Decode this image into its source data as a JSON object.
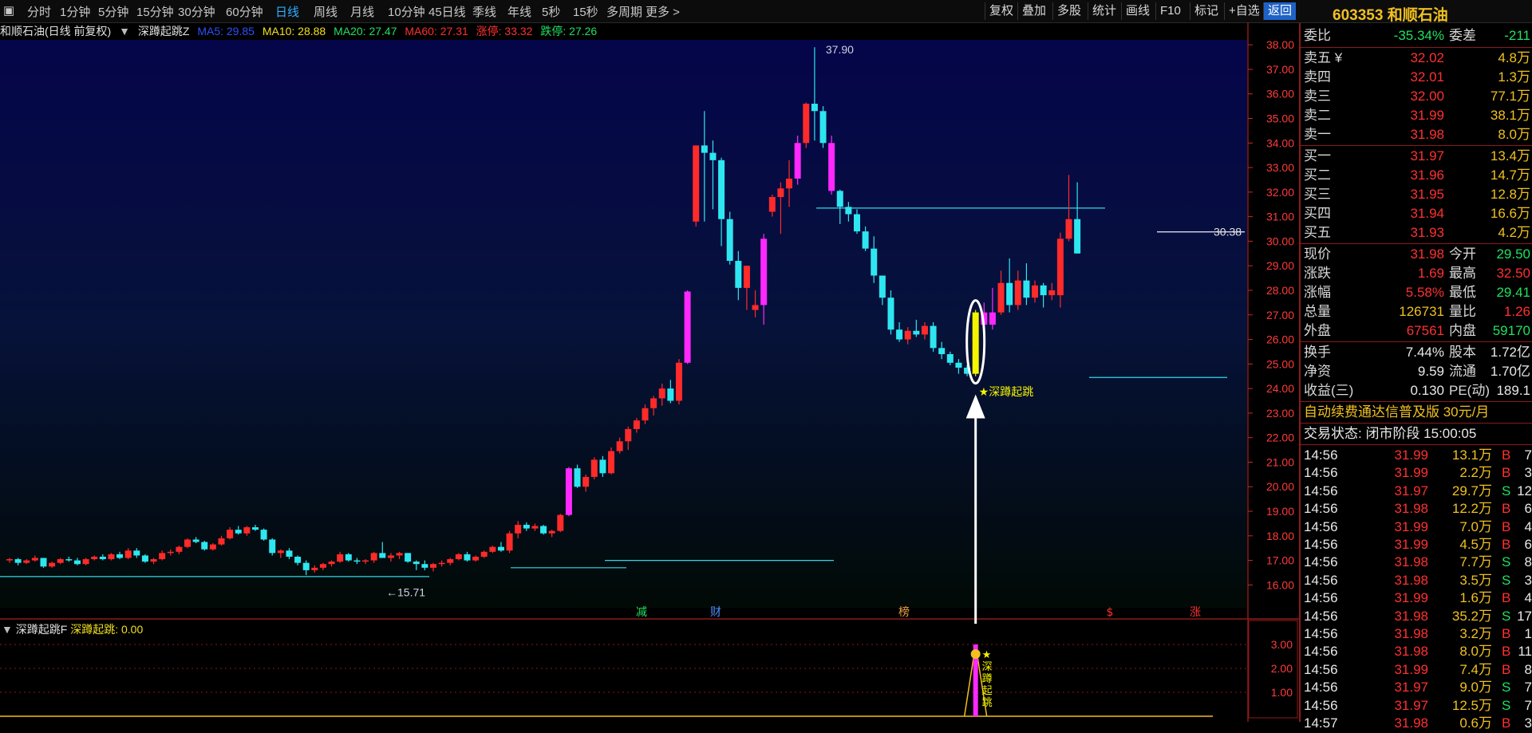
{
  "topbar": {
    "periods": [
      "分时",
      "1分钟",
      "5分钟",
      "15分钟",
      "30分钟",
      "60分钟",
      "日线",
      "周线",
      "月线",
      "10分钟",
      "45日线",
      "季线",
      "年线",
      "5秒",
      "15秒",
      "多周期",
      "更多 >"
    ],
    "active_period": "日线",
    "buttons": [
      "复权",
      "叠加",
      "多股",
      "统计",
      "画线",
      "F10",
      "标记",
      "+自选",
      "返回"
    ]
  },
  "stock": {
    "code": "603353",
    "name": "和顺石油"
  },
  "infobar": {
    "title": "和顺石油(日线 前复权)",
    "indicator_name": "深蹲起跳Z",
    "ma5": "MA5: 29.85",
    "ma10": "MA10: 28.88",
    "ma20": "MA20: 27.47",
    "ma60": "MA60: 27.31",
    "limit_up": "涨停: 33.32",
    "limit_down": "跌停: 27.26"
  },
  "sub_indicator": {
    "name": "深蹲起跳F",
    "value_label": "深蹲起跳: 0.00"
  },
  "chart_data": {
    "type": "candlestick",
    "y_axis": {
      "ticks": [
        16,
        17,
        18,
        19,
        20,
        21,
        22,
        23,
        24,
        25,
        26,
        27,
        28,
        29,
        30,
        31,
        32,
        33,
        34,
        35,
        36,
        37,
        38
      ],
      "ylim": [
        15.2,
        38.2
      ]
    },
    "annotations": {
      "high": "37.90",
      "low": "←15.71",
      "current": "30.38",
      "signal": "★深蹲起跳"
    },
    "event_markers": [
      "减",
      "财",
      "榜",
      "$",
      "涨"
    ],
    "sub_axis": {
      "ticks": [
        "3.00",
        "2.00",
        "1.00"
      ],
      "ylim": [
        0,
        3.6
      ]
    },
    "sub_signal_text": "★深蹲起跳",
    "candles": [
      [
        17.0,
        17.1,
        16.9,
        17.05
      ],
      [
        17.05,
        17.1,
        16.8,
        16.9
      ],
      [
        16.9,
        17.05,
        16.85,
        17.0
      ],
      [
        17.0,
        17.2,
        16.95,
        17.1
      ],
      [
        17.1,
        17.1,
        16.7,
        16.75
      ],
      [
        16.75,
        16.95,
        16.7,
        16.9
      ],
      [
        16.9,
        17.1,
        16.85,
        17.05
      ],
      [
        17.05,
        17.15,
        16.95,
        17.0
      ],
      [
        17.0,
        17.1,
        16.8,
        16.85
      ],
      [
        16.85,
        17.1,
        16.8,
        17.05
      ],
      [
        17.05,
        17.2,
        17.0,
        17.15
      ],
      [
        17.15,
        17.25,
        17.0,
        17.05
      ],
      [
        17.05,
        17.3,
        17.0,
        17.25
      ],
      [
        17.25,
        17.35,
        17.05,
        17.1
      ],
      [
        17.1,
        17.5,
        17.05,
        17.4
      ],
      [
        17.4,
        17.5,
        17.1,
        17.2
      ],
      [
        17.2,
        17.25,
        16.9,
        16.95
      ],
      [
        16.95,
        17.1,
        16.85,
        17.05
      ],
      [
        17.05,
        17.4,
        17.0,
        17.3
      ],
      [
        17.3,
        17.45,
        17.2,
        17.35
      ],
      [
        17.35,
        17.6,
        17.25,
        17.55
      ],
      [
        17.55,
        17.9,
        17.5,
        17.85
      ],
      [
        17.85,
        17.95,
        17.7,
        17.75
      ],
      [
        17.75,
        17.8,
        17.4,
        17.45
      ],
      [
        17.45,
        17.7,
        17.4,
        17.65
      ],
      [
        17.65,
        18.0,
        17.6,
        17.9
      ],
      [
        17.9,
        18.35,
        17.85,
        18.25
      ],
      [
        18.25,
        18.4,
        18.05,
        18.1
      ],
      [
        18.1,
        18.4,
        18.0,
        18.35
      ],
      [
        18.35,
        18.45,
        18.2,
        18.25
      ],
      [
        18.25,
        18.3,
        17.8,
        17.85
      ],
      [
        17.85,
        17.9,
        17.2,
        17.3
      ],
      [
        17.3,
        17.45,
        17.1,
        17.4
      ],
      [
        17.4,
        17.5,
        17.05,
        17.15
      ],
      [
        17.15,
        17.2,
        16.8,
        16.9
      ],
      [
        16.9,
        17.0,
        16.4,
        16.6
      ],
      [
        16.6,
        16.8,
        16.5,
        16.7
      ],
      [
        16.7,
        16.9,
        16.6,
        16.85
      ],
      [
        16.85,
        17.0,
        16.75,
        16.95
      ],
      [
        16.95,
        17.35,
        16.9,
        17.25
      ],
      [
        17.25,
        17.3,
        16.95,
        17.0
      ],
      [
        17.0,
        17.1,
        16.85,
        16.95
      ],
      [
        16.95,
        17.05,
        16.85,
        17.0
      ],
      [
        17.0,
        17.35,
        16.9,
        17.3
      ],
      [
        17.3,
        17.75,
        17.2,
        17.1
      ],
      [
        17.1,
        17.3,
        16.95,
        17.2
      ],
      [
        17.2,
        17.35,
        17.05,
        17.3
      ],
      [
        17.3,
        17.3,
        16.9,
        16.95
      ],
      [
        16.95,
        17.0,
        16.6,
        16.85
      ],
      [
        16.85,
        17.0,
        16.6,
        16.7
      ],
      [
        16.7,
        16.9,
        16.55,
        16.85
      ],
      [
        16.85,
        17.0,
        16.75,
        16.9
      ],
      [
        16.9,
        17.1,
        16.8,
        17.05
      ],
      [
        17.05,
        17.3,
        17.0,
        17.25
      ],
      [
        17.25,
        17.35,
        16.95,
        17.0
      ],
      [
        17.0,
        17.2,
        16.95,
        17.15
      ],
      [
        17.15,
        17.4,
        17.1,
        17.35
      ],
      [
        17.35,
        17.6,
        17.3,
        17.55
      ],
      [
        17.55,
        17.75,
        17.35,
        17.4
      ],
      [
        17.4,
        18.2,
        17.3,
        18.1
      ],
      [
        18.1,
        18.6,
        17.9,
        18.45
      ],
      [
        18.45,
        18.55,
        18.2,
        18.3
      ],
      [
        18.3,
        18.5,
        18.2,
        18.4
      ],
      [
        18.4,
        18.45,
        18.05,
        18.1
      ],
      [
        18.1,
        18.25,
        17.95,
        18.2
      ],
      [
        18.2,
        18.9,
        18.15,
        18.85
      ],
      [
        18.85,
        20.8,
        18.8,
        20.75
      ],
      [
        20.75,
        20.9,
        19.95,
        20.0
      ],
      [
        20.0,
        20.5,
        19.8,
        20.4
      ],
      [
        20.4,
        21.2,
        20.3,
        21.1
      ],
      [
        21.1,
        21.25,
        20.4,
        20.55
      ],
      [
        20.55,
        21.6,
        20.5,
        21.45
      ],
      [
        21.45,
        22.0,
        21.35,
        21.85
      ],
      [
        21.85,
        22.45,
        21.5,
        22.35
      ],
      [
        22.35,
        22.8,
        22.2,
        22.7
      ],
      [
        22.7,
        23.35,
        22.55,
        23.2
      ],
      [
        23.2,
        23.7,
        22.9,
        23.6
      ],
      [
        23.6,
        24.2,
        23.3,
        24.0
      ],
      [
        24.0,
        24.35,
        23.4,
        23.5
      ],
      [
        23.5,
        25.2,
        23.35,
        25.05
      ],
      [
        25.05,
        28.0,
        25.0,
        27.95
      ],
      [
        30.8,
        33.9,
        30.6,
        33.9
      ],
      [
        33.9,
        35.3,
        30.8,
        33.6
      ],
      [
        33.6,
        34.1,
        31.3,
        33.3
      ],
      [
        33.3,
        33.4,
        29.8,
        30.9
      ],
      [
        30.9,
        31.2,
        29.05,
        29.2
      ],
      [
        29.2,
        29.6,
        27.6,
        28.1
      ],
      [
        28.1,
        29.0,
        27.2,
        29.0
      ],
      [
        27.2,
        28.0,
        26.9,
        27.4
      ],
      [
        27.4,
        30.3,
        26.6,
        30.1
      ],
      [
        31.2,
        31.9,
        31.0,
        31.8
      ],
      [
        31.8,
        32.4,
        30.3,
        32.15
      ],
      [
        32.15,
        33.3,
        31.4,
        32.55
      ],
      [
        32.55,
        34.3,
        32.3,
        34.0
      ],
      [
        34.0,
        35.65,
        33.8,
        35.6
      ],
      [
        35.6,
        37.9,
        34.1,
        35.3
      ],
      [
        35.3,
        35.5,
        33.8,
        34.0
      ],
      [
        34.0,
        34.3,
        31.9,
        32.05
      ],
      [
        32.05,
        32.1,
        30.7,
        31.4
      ],
      [
        31.4,
        31.6,
        30.8,
        31.1
      ],
      [
        31.1,
        31.3,
        30.3,
        30.4
      ],
      [
        30.4,
        30.6,
        29.6,
        29.7
      ],
      [
        29.7,
        30.2,
        28.3,
        28.6
      ],
      [
        28.6,
        28.6,
        27.4,
        27.7
      ],
      [
        27.7,
        28.0,
        26.2,
        26.4
      ],
      [
        26.4,
        26.7,
        25.9,
        26.0
      ],
      [
        26.0,
        26.5,
        25.8,
        26.35
      ],
      [
        26.35,
        26.8,
        26.1,
        26.2
      ],
      [
        26.2,
        26.7,
        26.0,
        26.55
      ],
      [
        26.55,
        26.7,
        25.5,
        25.65
      ],
      [
        25.65,
        25.9,
        25.2,
        25.4
      ],
      [
        25.4,
        25.5,
        24.95,
        25.05
      ],
      [
        25.05,
        25.2,
        24.6,
        24.85
      ],
      [
        24.85,
        24.95,
        24.5,
        24.6
      ],
      [
        24.6,
        27.2,
        24.5,
        27.1
      ],
      [
        27.1,
        27.5,
        26.3,
        26.6
      ],
      [
        26.6,
        28.1,
        26.4,
        27.1
      ],
      [
        27.1,
        28.8,
        27.0,
        28.3
      ],
      [
        28.3,
        29.3,
        27.1,
        27.4
      ],
      [
        27.4,
        28.8,
        27.2,
        28.4
      ],
      [
        28.4,
        29.1,
        27.4,
        27.7
      ],
      [
        27.7,
        28.4,
        27.5,
        28.2
      ],
      [
        28.2,
        28.3,
        27.3,
        27.8
      ],
      [
        27.8,
        28.3,
        27.6,
        28.0
      ],
      [
        27.8,
        30.35,
        27.3,
        30.1
      ],
      [
        30.1,
        32.7,
        30.0,
        30.9
      ],
      [
        30.9,
        32.4,
        29.5,
        29.5
      ]
    ]
  },
  "quote": {
    "weibi_label": "委比",
    "weibi": "-35.34%",
    "weicha_label": "委差",
    "weicha": "-211",
    "asks": [
      {
        "label": "卖五 ¥",
        "price": "32.02",
        "vol": "4.8万"
      },
      {
        "label": "卖四",
        "price": "32.01",
        "vol": "1.3万"
      },
      {
        "label": "卖三",
        "price": "32.00",
        "vol": "77.1万"
      },
      {
        "label": "卖二",
        "price": "31.99",
        "vol": "38.1万"
      },
      {
        "label": "卖一",
        "price": "31.98",
        "vol": "8.0万"
      }
    ],
    "bids": [
      {
        "label": "买一",
        "price": "31.97",
        "vol": "13.4万"
      },
      {
        "label": "买二",
        "price": "31.96",
        "vol": "14.7万"
      },
      {
        "label": "买三",
        "price": "31.95",
        "vol": "12.8万"
      },
      {
        "label": "买四",
        "price": "31.94",
        "vol": "16.6万"
      },
      {
        "label": "买五",
        "price": "31.93",
        "vol": "4.2万"
      }
    ],
    "stats": [
      {
        "l1": "现价",
        "v1": "31.98",
        "c1": "red",
        "l2": "今开",
        "v2": "29.50",
        "c2": "green"
      },
      {
        "l1": "涨跌",
        "v1": "1.69",
        "c1": "red",
        "l2": "最高",
        "v2": "32.50",
        "c2": "red"
      },
      {
        "l1": "涨幅",
        "v1": "5.58%",
        "c1": "red",
        "l2": "最低",
        "v2": "29.41",
        "c2": "green"
      },
      {
        "l1": "总量",
        "v1": "126731",
        "c1": "yellow",
        "l2": "量比",
        "v2": "1.26",
        "c2": "red"
      },
      {
        "l1": "外盘",
        "v1": "67561",
        "c1": "red",
        "l2": "内盘",
        "v2": "59170",
        "c2": "green"
      }
    ],
    "stats2": [
      {
        "l1": "换手",
        "v1": "7.44%",
        "l2": "股本",
        "v2": "1.72亿"
      },
      {
        "l1": "净资",
        "v1": "9.59",
        "l2": "流通",
        "v2": "1.70亿"
      },
      {
        "l1": "收益(三)",
        "v1": "0.130",
        "l2": "PE(动)",
        "v2": "189.1"
      }
    ],
    "ad_text": "自动续费通达信普及版 30元/月",
    "trade_state": "交易状态: 闭市阶段 15:00:05"
  },
  "ticks": [
    [
      "14:56",
      "31.99",
      "13.1万",
      "B",
      "7"
    ],
    [
      "14:56",
      "31.99",
      "2.2万",
      "B",
      "3"
    ],
    [
      "14:56",
      "31.97",
      "29.7万",
      "S",
      "12"
    ],
    [
      "14:56",
      "31.98",
      "12.2万",
      "B",
      "6"
    ],
    [
      "14:56",
      "31.99",
      "7.0万",
      "B",
      "4"
    ],
    [
      "14:56",
      "31.99",
      "4.5万",
      "B",
      "6"
    ],
    [
      "14:56",
      "31.98",
      "7.7万",
      "S",
      "8"
    ],
    [
      "14:56",
      "31.98",
      "3.5万",
      "S",
      "3"
    ],
    [
      "14:56",
      "31.99",
      "1.6万",
      "B",
      "4"
    ],
    [
      "14:56",
      "31.98",
      "35.2万",
      "S",
      "17"
    ],
    [
      "14:56",
      "31.98",
      "3.2万",
      "B",
      "1"
    ],
    [
      "14:56",
      "31.98",
      "8.0万",
      "B",
      "11"
    ],
    [
      "14:56",
      "31.99",
      "7.4万",
      "B",
      "8"
    ],
    [
      "14:56",
      "31.97",
      "9.0万",
      "S",
      "7"
    ],
    [
      "14:56",
      "31.97",
      "12.5万",
      "S",
      "7"
    ],
    [
      "14:57",
      "31.98",
      "0.6万",
      "B",
      "3"
    ]
  ],
  "colors": {
    "up": "#ff2a2a",
    "down": "#2ee6f0",
    "magenta": "#ff28ff",
    "signal": "#f5f500",
    "accent": "#1e62c8"
  }
}
